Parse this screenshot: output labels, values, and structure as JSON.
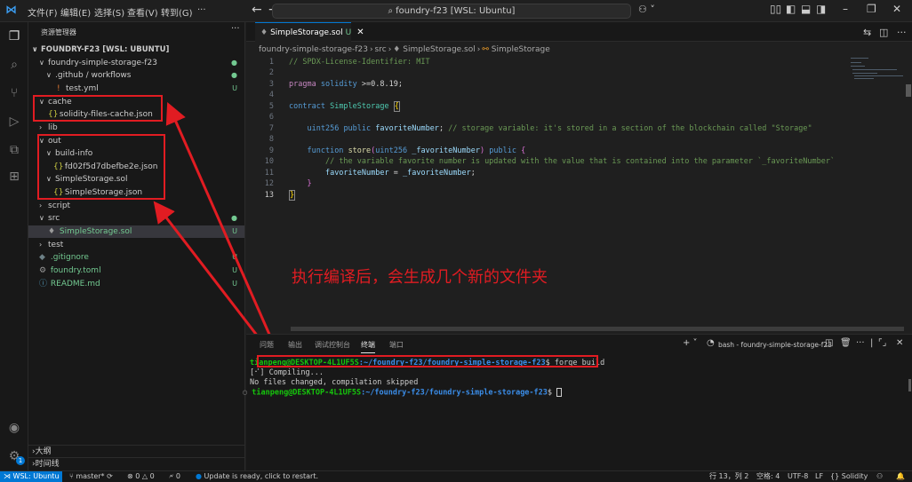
{
  "titlebar": {
    "menus": [
      "文件(F)",
      "编辑(E)",
      "选择(S)",
      "查看(V)",
      "转到(G)",
      "···"
    ],
    "search_text": "foundry-f23 [WSL: Ubuntu]"
  },
  "sidebar": {
    "header": "资源管理器",
    "more": "···",
    "root": "FOUNDRY-F23 [WSL: UBUNTU]",
    "items": [
      {
        "label": "foundry-simple-storage-f23",
        "deco": "●"
      },
      {
        "label": ".github / workflows",
        "deco": "●"
      },
      {
        "label": "test.yml",
        "deco": "U"
      },
      {
        "label": "cache",
        "deco": ""
      },
      {
        "label": "solidity-files-cache.json",
        "deco": ""
      },
      {
        "label": "lib",
        "deco": ""
      },
      {
        "label": "out",
        "deco": ""
      },
      {
        "label": "build-info",
        "deco": ""
      },
      {
        "label": "fd02f5d7dbefbe2e.json",
        "deco": ""
      },
      {
        "label": "SimpleStorage.sol",
        "deco": ""
      },
      {
        "label": "SimpleStorage.json",
        "deco": ""
      },
      {
        "label": "script",
        "deco": ""
      },
      {
        "label": "src",
        "deco": "●"
      },
      {
        "label": "SimpleStorage.sol",
        "deco": "U"
      },
      {
        "label": "test",
        "deco": ""
      },
      {
        "label": ".gitignore",
        "deco": "U"
      },
      {
        "label": "foundry.toml",
        "deco": "U"
      },
      {
        "label": "README.md",
        "deco": "U"
      }
    ],
    "outline": "大纲",
    "timeline": "时间线"
  },
  "editor": {
    "tab_label": "SimpleStorage.sol",
    "tab_status": "U",
    "breadcrumb": [
      "foundry-simple-storage-f23",
      "src",
      "SimpleStorage.sol",
      "SimpleStorage"
    ],
    "lines": {
      "1": "// SPDX-License-Identifier: MIT",
      "7_comment": "// storage variable: it's stored in a section of the blockchain called \"Storage\"",
      "10": "// the variable favorite number is updated with the value that is contained into the parameter `_favoriteNumber`"
    }
  },
  "annotation": "执行编译后，会生成几个新的文件夹",
  "panel": {
    "tabs": [
      "问题",
      "输出",
      "调试控制台",
      "终端",
      "端口"
    ],
    "terminal_name": "bash - foundry-simple-storage-f23",
    "user": "tianpeng@DESKTOP-4L1UF5S",
    "path": ":~/foundry-f23/foundry-simple-storage-f23",
    "command": " forge build",
    "out1": "[⠊] Compiling...",
    "out2": "No files changed, compilation skipped"
  },
  "statusbar": {
    "remote": "WSL: Ubuntu",
    "branch": "master*",
    "problems": "⊗ 0 △ 0",
    "ports": "🗲 0",
    "update": "Update is ready, click to restart.",
    "position": "行 13，列 2",
    "spaces": "空格: 4",
    "encoding": "UTF-8",
    "eol": "LF",
    "language": "Solidity"
  },
  "colors": {
    "annotation": "#e11c22",
    "accent": "#0078d4",
    "terminal_user": "#16c60c",
    "terminal_path": "#3b8eea"
  }
}
